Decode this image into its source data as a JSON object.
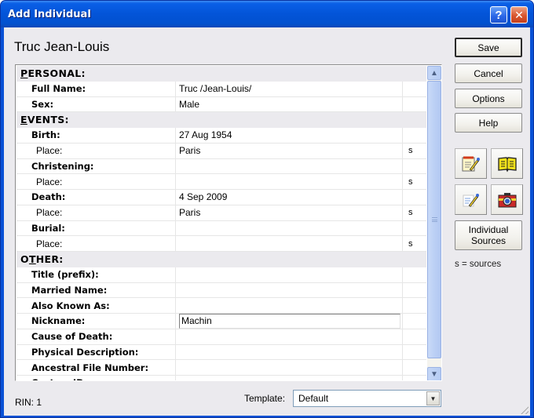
{
  "window": {
    "title": "Add Individual",
    "help_glyph": "?",
    "close_glyph": "✕"
  },
  "person_name": "Truc Jean-Louis",
  "grid": {
    "sections": {
      "personal": {
        "accel": "P",
        "rest": "ERSONAL:"
      },
      "events": {
        "accel": "E",
        "rest": "VENTS:"
      },
      "other": {
        "pre": "O",
        "accel": "T",
        "rest": "HER:"
      }
    },
    "personal_rows": [
      {
        "label": "Full Name:",
        "value": "Truc /Jean-Louis/",
        "src": ""
      },
      {
        "label": "Sex:",
        "value": "Male",
        "src": ""
      }
    ],
    "event_rows": [
      {
        "label": "Birth:",
        "value": "27 Aug 1954",
        "src": "",
        "sub": false
      },
      {
        "label": "Place:",
        "value": "Paris",
        "src": "s",
        "sub": true
      },
      {
        "label": "Christening:",
        "value": "",
        "src": "",
        "sub": false
      },
      {
        "label": "Place:",
        "value": "",
        "src": "s",
        "sub": true
      },
      {
        "label": "Death:",
        "value": "4 Sep 2009",
        "src": "",
        "sub": false
      },
      {
        "label": "Place:",
        "value": "Paris",
        "src": "s",
        "sub": true
      },
      {
        "label": "Burial:",
        "value": "",
        "src": "",
        "sub": false
      },
      {
        "label": "Place:",
        "value": "",
        "src": "s",
        "sub": true
      }
    ],
    "other_rows": [
      {
        "label": "Title (prefix):",
        "value": ""
      },
      {
        "label": "Married Name:",
        "value": ""
      },
      {
        "label": "Also Known As:",
        "value": ""
      },
      {
        "label": "Nickname:",
        "value": "Machin",
        "editing": true
      },
      {
        "label": "Cause of Death:",
        "value": ""
      },
      {
        "label": "Physical Description:",
        "value": ""
      },
      {
        "label": "Ancestral File Number:",
        "value": ""
      },
      {
        "label": "Custom ID:",
        "value": ""
      }
    ]
  },
  "buttons": {
    "save": "Save",
    "cancel": "Cancel",
    "options": "Options",
    "help": "Help",
    "individual_sources_line1": "Individual",
    "individual_sources_line2": "Sources"
  },
  "legend": "s = sources",
  "footer": {
    "rin": "RIN: 1",
    "template_label": "Template:",
    "template_value": "Default"
  }
}
